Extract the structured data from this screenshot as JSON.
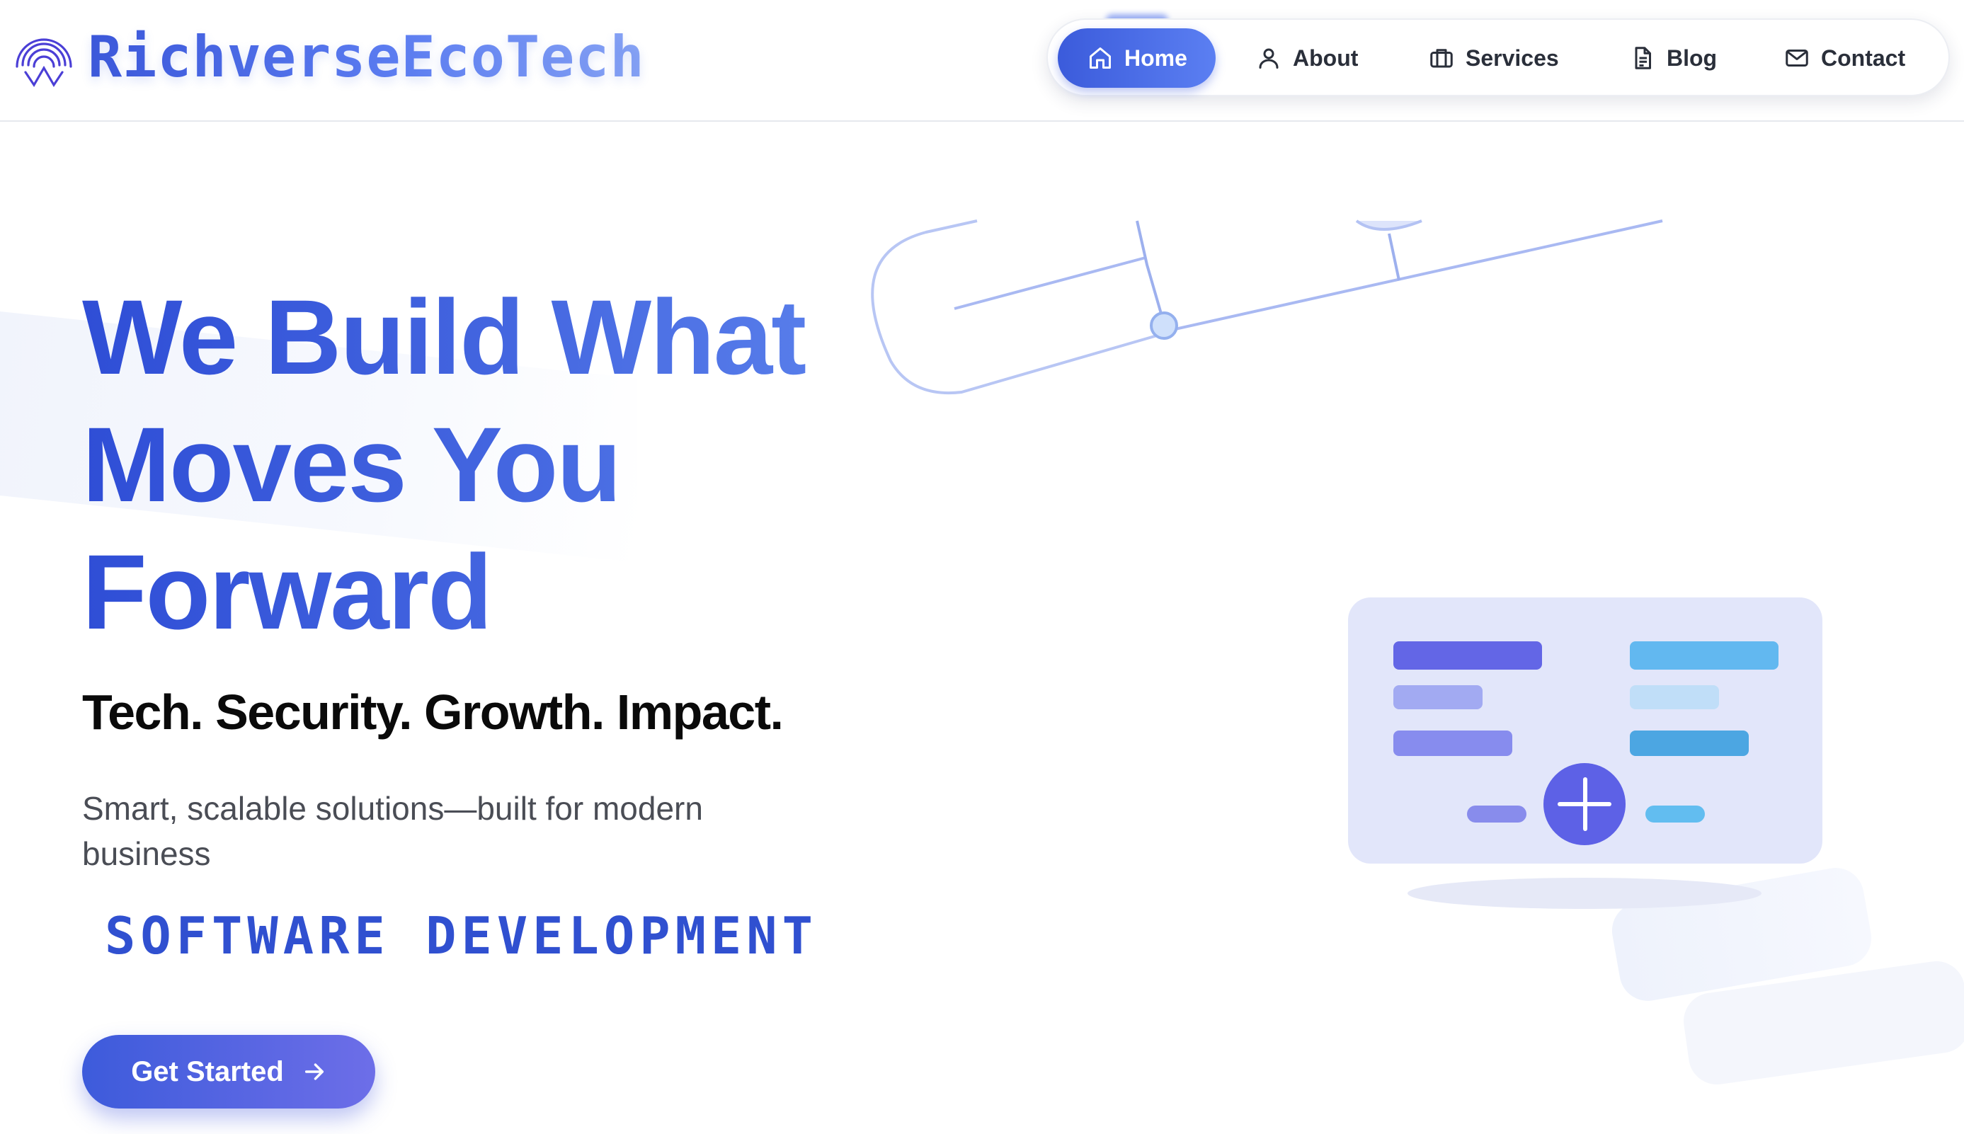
{
  "brand": {
    "name": "RichverseEcoTech",
    "logo_icon": "fingerprint-w-icon"
  },
  "nav": {
    "items": [
      {
        "label": "Home",
        "icon": "home-icon",
        "active": true
      },
      {
        "label": "About",
        "icon": "user-icon",
        "active": false
      },
      {
        "label": "Services",
        "icon": "briefcase-icon",
        "active": false
      },
      {
        "label": "Blog",
        "icon": "document-icon",
        "active": false
      },
      {
        "label": "Contact",
        "icon": "mail-icon",
        "active": false
      }
    ]
  },
  "hero": {
    "headline_lines": [
      "We Build What",
      "Moves You",
      "Forward"
    ],
    "tagline": "Tech. Security. Growth. Impact.",
    "subtext": "Smart, scalable solutions—built for modern business",
    "specialty": "SOFTWARE DEVELOPMENT",
    "cta_label": "Get Started",
    "cta_icon": "arrow-right-icon"
  },
  "colors": {
    "primary": "#3b5bdb",
    "primary_light": "#5b7ff2",
    "accent_purple": "#5d61e6",
    "accent_sky": "#5fb5f0",
    "text_dark": "#0a0a0a",
    "text_muted": "#4a4d55"
  }
}
